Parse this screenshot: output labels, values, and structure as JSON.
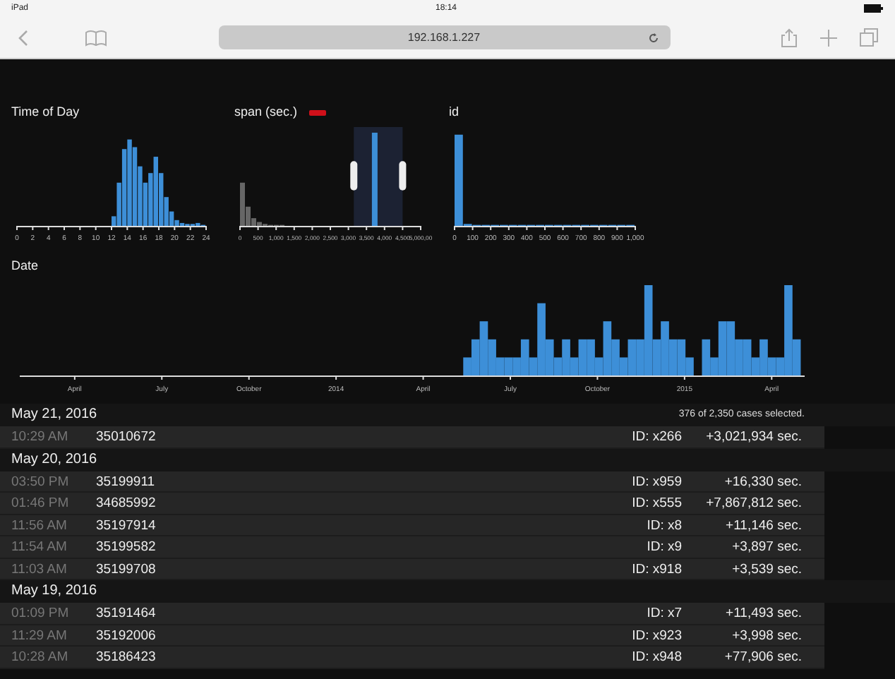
{
  "browser": {
    "status_bar": {
      "device": "iPad",
      "time": "18:14"
    },
    "address": "192.168.1.227"
  },
  "charts": [
    {
      "title": "Time of Day",
      "filtered": false,
      "ticks": [
        "0",
        "2",
        "4",
        "6",
        "8",
        "10",
        "12",
        "14",
        "16",
        "18",
        "20",
        "22",
        "24"
      ]
    },
    {
      "title": "span (sec.)",
      "filtered": true,
      "ticks": [
        "0",
        "500",
        "1,000",
        "1,500",
        "2,000",
        "2,500",
        "3,000",
        "3,500",
        "4,000",
        "4,500",
        "5,000,00"
      ]
    },
    {
      "title": "id",
      "filtered": false,
      "ticks": [
        "0",
        "100",
        "200",
        "300",
        "400",
        "500",
        "600",
        "700",
        "800",
        "900",
        "1,000"
      ]
    }
  ],
  "date_chart": {
    "title": "Date",
    "ticks": [
      "April",
      "July",
      "October",
      "2014",
      "April",
      "July",
      "October",
      "2015",
      "April"
    ]
  },
  "summary": "376 of 2,350 cases selected.",
  "groups": [
    {
      "date": "May 21, 2016",
      "rows": [
        {
          "time": "10:29 AM",
          "number": "35010672",
          "id": "ID: x266",
          "span": "+3,021,934 sec."
        }
      ]
    },
    {
      "date": "May 20, 2016",
      "rows": [
        {
          "time": "03:50 PM",
          "number": "35199911",
          "id": "ID: x959",
          "span": "+16,330 sec."
        },
        {
          "time": "01:46 PM",
          "number": "34685992",
          "id": "ID: x555",
          "span": "+7,867,812 sec."
        },
        {
          "time": "11:56 AM",
          "number": "35197914",
          "id": "ID: x8",
          "span": "+11,146 sec."
        },
        {
          "time": "11:54 AM",
          "number": "35199582",
          "id": "ID: x9",
          "span": "+3,897 sec."
        },
        {
          "time": "11:03 AM",
          "number": "35199708",
          "id": "ID: x918",
          "span": "+3,539 sec."
        }
      ]
    },
    {
      "date": "May 19, 2016",
      "rows": [
        {
          "time": "01:09 PM",
          "number": "35191464",
          "id": "ID: x7",
          "span": "+11,493 sec."
        },
        {
          "time": "11:29 AM",
          "number": "35192006",
          "id": "ID: x923",
          "span": "+3,998 sec."
        },
        {
          "time": "10:28 AM",
          "number": "35186423",
          "id": "ID: x948",
          "span": "+77,906 sec."
        }
      ]
    }
  ]
}
